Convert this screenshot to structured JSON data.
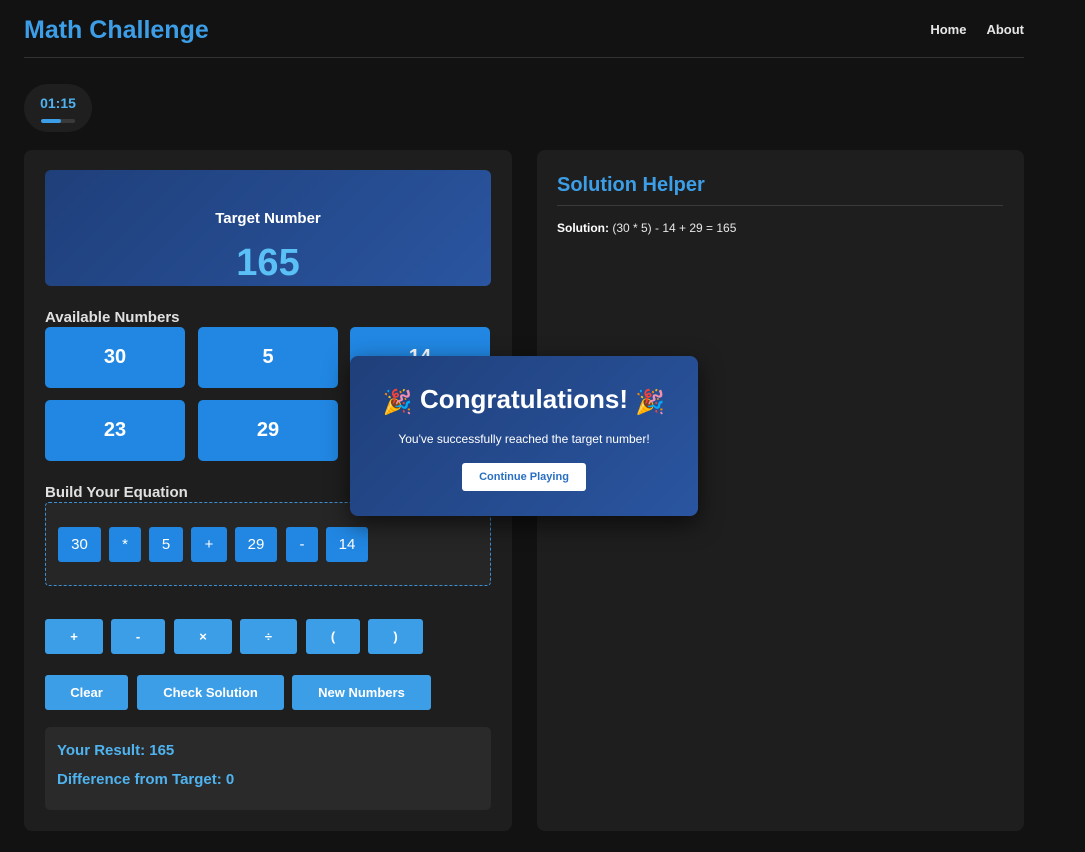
{
  "header": {
    "title": "Math Challenge",
    "nav": [
      "Home",
      "About"
    ]
  },
  "timer": {
    "text": "01:15",
    "progress": 0.6
  },
  "target": {
    "label": "Target Number",
    "value": "165"
  },
  "available": {
    "label": "Available Numbers",
    "numbers": [
      "30",
      "5",
      "14",
      "23",
      "29"
    ]
  },
  "equation": {
    "label": "Build Your Equation",
    "tokens": [
      "30",
      "*",
      "5",
      "+",
      "29",
      "-",
      "14"
    ]
  },
  "operators": [
    "+",
    "-",
    "×",
    "÷",
    "(",
    ")"
  ],
  "actions": {
    "clear": "Clear",
    "check": "Check Solution",
    "new": "New Numbers"
  },
  "result": {
    "your_result": "Your Result: 165",
    "difference": "Difference from Target: 0"
  },
  "helper": {
    "title": "Solution Helper",
    "solution_label": "Solution:",
    "solution_value": " (30 * 5) - 14 + 29 = 165"
  },
  "modal": {
    "emoji": "🎉",
    "title": "Congratulations!",
    "text": "You've successfully reached the target number!",
    "button": "Continue Playing"
  },
  "colors": {
    "accent": "#3d9ee8",
    "button": "#2187e3",
    "background": "#121212"
  }
}
